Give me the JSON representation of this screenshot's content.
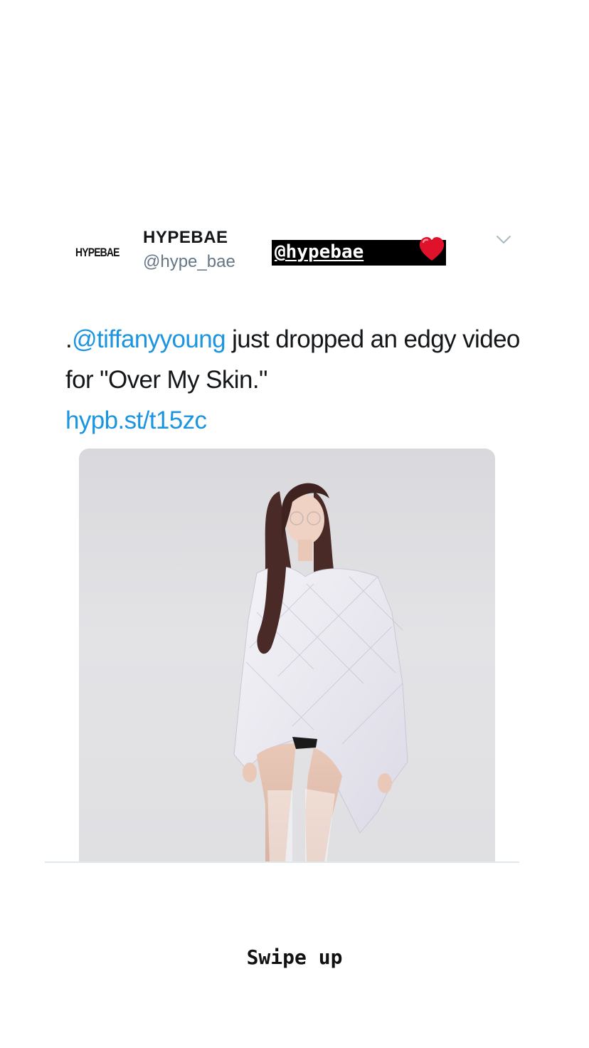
{
  "tweet": {
    "avatar_logo_text": "HYPEBAE",
    "display_name": "HYPEBAE",
    "handle": "@hype_bae",
    "text_prefix": ".",
    "mention": "@tiffanyyoung",
    "text_body": " just dropped an edgy video for \"Over My Skin.\"",
    "link": "hypb.st/t15zc",
    "menu_icon": "chevron-down-icon",
    "media_alt_icon": "photo"
  },
  "story_overlay": {
    "mention_sticker": "@hypebae",
    "sticker_icon": "heart-icon",
    "swipe_up_label": "Swipe up"
  },
  "colors": {
    "link": "#1b95e0",
    "text": "#14171a",
    "secondary_text": "#657786",
    "sticker_bg": "#000000",
    "heart": "#e0112b"
  }
}
